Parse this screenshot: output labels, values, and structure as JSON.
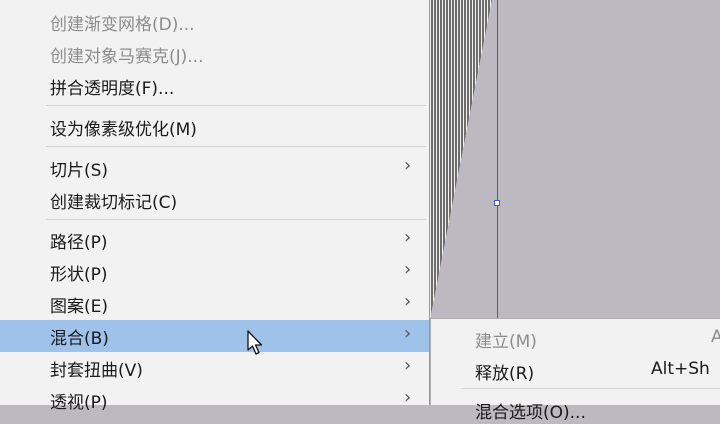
{
  "context_menu": {
    "items": [
      {
        "label": "创建渐变网格(D)..."
      },
      {
        "label": "创建对象马赛克(J)..."
      },
      {
        "label": "拼合透明度(F)..."
      },
      {
        "label": "设为像素级优化(M)"
      },
      {
        "label": "切片(S)"
      },
      {
        "label": "创建裁切标记(C)"
      },
      {
        "label": "路径(P)"
      },
      {
        "label": "形状(P)"
      },
      {
        "label": "图案(E)"
      },
      {
        "label": "混合(B)"
      },
      {
        "label": "封套扭曲(V)"
      },
      {
        "label": "透视(P)"
      }
    ]
  },
  "blend_submenu": {
    "items": [
      {
        "label": "建立(M)",
        "shortcut": "A"
      },
      {
        "label": "释放(R)",
        "shortcut": "Alt+Sh"
      },
      {
        "label": "混合选项(O)..."
      }
    ]
  },
  "icons": {
    "submenu_arrow": "chevron-right-icon",
    "cursor": "mouse-pointer-icon"
  },
  "colors": {
    "highlight": "#9fc2eb",
    "guide": "#3d5ccc",
    "menu_bg": "#f2f2f2"
  }
}
